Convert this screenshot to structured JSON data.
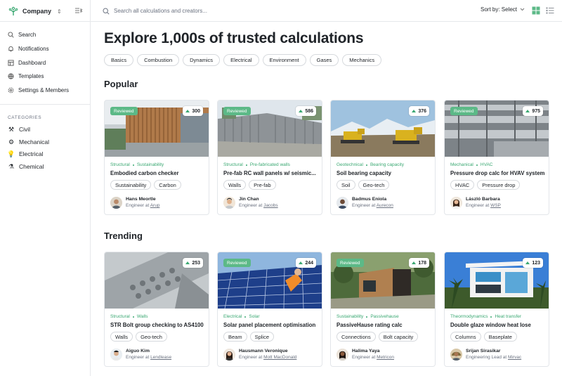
{
  "topbar": {
    "brand": "Company",
    "search_placeholder": "Search all calculations and creators...",
    "sort_label": "Sort by: Select"
  },
  "sidebar": {
    "nav": [
      {
        "label": "Search",
        "icon": "search-icon"
      },
      {
        "label": "Notifications",
        "icon": "bell-icon"
      },
      {
        "label": "Dashboard",
        "icon": "dashboard-icon"
      },
      {
        "label": "Templates",
        "icon": "globe-icon"
      },
      {
        "label": "Settings & Members",
        "icon": "gear-icon"
      }
    ],
    "categories_title": "CATEGORIES",
    "categories": [
      {
        "label": "Civil",
        "icon": "tools-icon"
      },
      {
        "label": "Mechanical",
        "icon": "cog-icon"
      },
      {
        "label": "Electrical",
        "icon": "bulb-icon"
      },
      {
        "label": "Chemical",
        "icon": "flask-icon"
      }
    ]
  },
  "main": {
    "title": "Explore 1,000s of trusted calculations",
    "filters": [
      "Basics",
      "Combustion",
      "Dynamics",
      "Electrical",
      "Environment",
      "Gases",
      "Mechanics"
    ],
    "sections": [
      {
        "title": "Popular",
        "cards": [
          {
            "reviewed": "Reviewed",
            "votes": "300",
            "tag1": "Structural",
            "tag2": "Sustainability",
            "title": "Embodied carbon checker",
            "pills": [
              "Sustainability",
              "Carbon"
            ],
            "author": "Hans Meortle",
            "role": "Engineer at",
            "company": "Arup"
          },
          {
            "reviewed": "Reviewed",
            "votes": "586",
            "tag1": "Structural",
            "tag2": "Pre-fabricated walls",
            "title": "Pre-fab RC wall panels w/ seismic...",
            "pills": [
              "Walls",
              "Pre-fab"
            ],
            "author": "Jin Chan",
            "role": "Engineer at",
            "company": "Jacobs"
          },
          {
            "reviewed": "",
            "votes": "376",
            "tag1": "Geotechnical",
            "tag2": "Bearing capacity",
            "title": "Soil bearing capacity",
            "pills": [
              "Soil",
              "Geo-tech"
            ],
            "author": "Badmus Eniola",
            "role": "Engineer at",
            "company": "Aurecon"
          },
          {
            "reviewed": "Reviewed",
            "votes": "975",
            "tag1": "Mechanical",
            "tag2": "HVAC",
            "title": "Pressure drop calc for HVAV system",
            "pills": [
              "HVAC",
              "Pressure drop"
            ],
            "author": "László Barbara",
            "role": "Engineer at",
            "company": "WSP"
          }
        ]
      },
      {
        "title": "Trending",
        "cards": [
          {
            "reviewed": "",
            "votes": "253",
            "tag1": "Structural",
            "tag2": "Walls",
            "title": "STR Bolt group checking to AS4100",
            "pills": [
              "Walls",
              "Geo-tech"
            ],
            "author": "Aiguo Kim",
            "role": "Engineer at",
            "company": "Lendlease"
          },
          {
            "reviewed": "Reviewed",
            "votes": "244",
            "tag1": "Electrical",
            "tag2": "Solar",
            "title": "Solar panel placement optimisation",
            "pills": [
              "Beam",
              "Splice"
            ],
            "author": "Hausmann Veronique",
            "role": "Engineer at",
            "company": "Mott MacDonald"
          },
          {
            "reviewed": "Reviewed",
            "votes": "178",
            "tag1": "Sustainability",
            "tag2": "Passivehause",
            "title": "PassiveHause rating calc",
            "pills": [
              "Connections",
              "Bolt capacity"
            ],
            "author": "Halima Yaya",
            "role": "Engineer at",
            "company": "Metricon"
          },
          {
            "reviewed": "",
            "votes": "123",
            "tag1": "Theormodynamics",
            "tag2": "Heat transfer",
            "title": "Double glaze window heat lose",
            "pills": [
              "Columns",
              "Baseplate"
            ],
            "author": "Srijan Sirasikar",
            "role": "Engineering Lead at",
            "company": "Mirvac"
          }
        ]
      }
    ]
  },
  "colors": {
    "accent": "#3aa872",
    "badge": "#5cb987",
    "grid_view_active": "#5cb987"
  }
}
